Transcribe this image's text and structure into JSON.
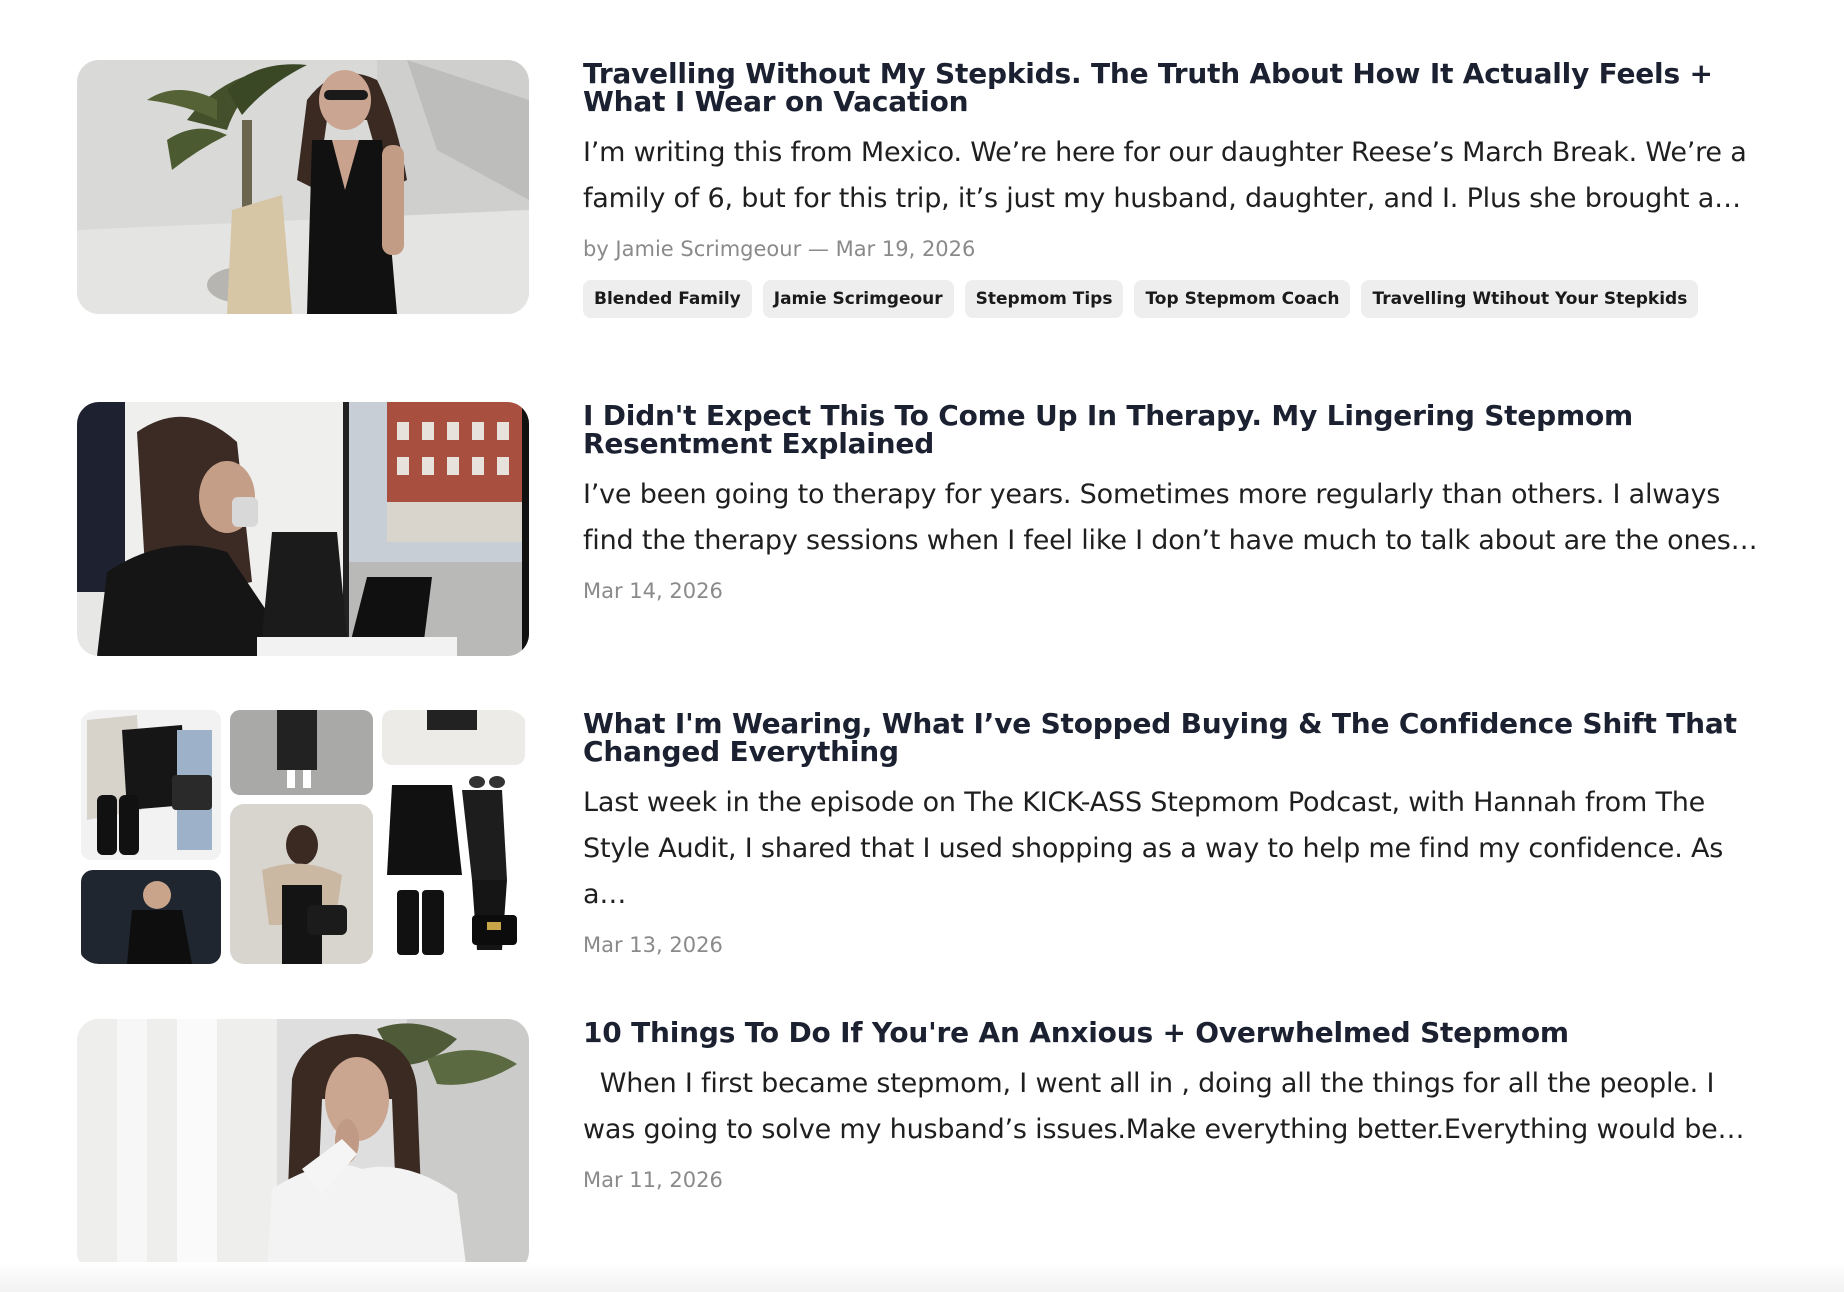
{
  "posts": [
    {
      "title": "Travelling Without My Stepkids. The Truth About How It Actually Feels + What I Wear on Vacation",
      "excerpt": "I’m writing this from Mexico. We’re here for our daughter Reese’s March Break. We’re a family of 6, but for this trip, it’s just my husband, daughter, and I. Plus she brought a…",
      "meta": "by Jamie Scrimgeour — Mar 19, 2026",
      "tags": [
        "Blended Family",
        "Jamie Scrimgeour",
        "Stepmom Tips",
        "Top Stepmom Coach",
        "Travelling Wtihout Your Stepkids"
      ],
      "image": "woman-palm-tree-photo"
    },
    {
      "title": "I Didn't Expect This To Come Up In Therapy. My Lingering Stepmom Resentment Explained",
      "excerpt": "I’ve been going to therapy for years. Sometimes more regularly than others. I always find the therapy sessions when I feel like I don’t have much to talk about are the ones…",
      "meta": "Mar 14, 2026",
      "image": "woman-coffee-window-photo"
    },
    {
      "title": "What I'm Wearing, What I’ve Stopped Buying & The Confidence Shift That Changed Everything",
      "excerpt": "Last week in the episode on The KICK-ASS Stepmom Podcast, with Hannah from The Style Audit, I shared that I used shopping as a way to help me find my confidence. As a…",
      "meta": "Mar 13, 2026",
      "image": "outfit-collage-photo"
    },
    {
      "title": "10 Things To Do If You're An Anxious + Overwhelmed Stepmom",
      "excerpt": "  When I first became stepmom, I went all in , doing all the things for all the people. I was going to solve my husband’s issues.Make everything better.Everything would be…",
      "meta": "Mar 11, 2026",
      "image": "woman-thinking-portrait-photo"
    }
  ]
}
